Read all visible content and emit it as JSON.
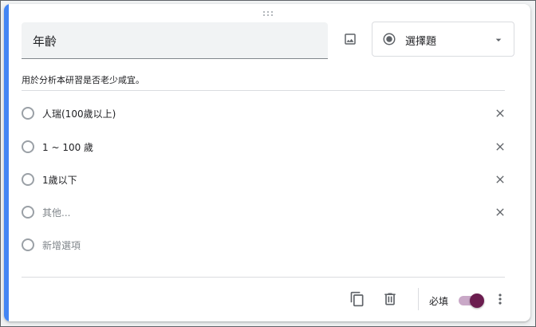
{
  "question": {
    "title": "年齡",
    "description": "用於分析本研習是否老少咸宜。",
    "type_label": "選擇題"
  },
  "options": [
    {
      "label": "人瑞(100歲以上)"
    },
    {
      "label": "1 ~ 100 歲"
    },
    {
      "label": "1歲以下"
    },
    {
      "label": "其他..."
    },
    {
      "label": "新增選項"
    }
  ],
  "footer": {
    "required_label": "必填",
    "required": true
  },
  "icons": {
    "image": "image-icon",
    "type": "radio-button-checked-icon",
    "dropdown": "arrow-drop-down-icon",
    "remove": "close-icon",
    "duplicate": "copy-icon",
    "delete": "trash-icon",
    "more": "more-vert-icon",
    "drag": "drag-handle-icon"
  },
  "colors": {
    "accent": "#4285f4",
    "toggle_on": "#6b1d4f",
    "toggle_track": "#c9a8c7"
  }
}
